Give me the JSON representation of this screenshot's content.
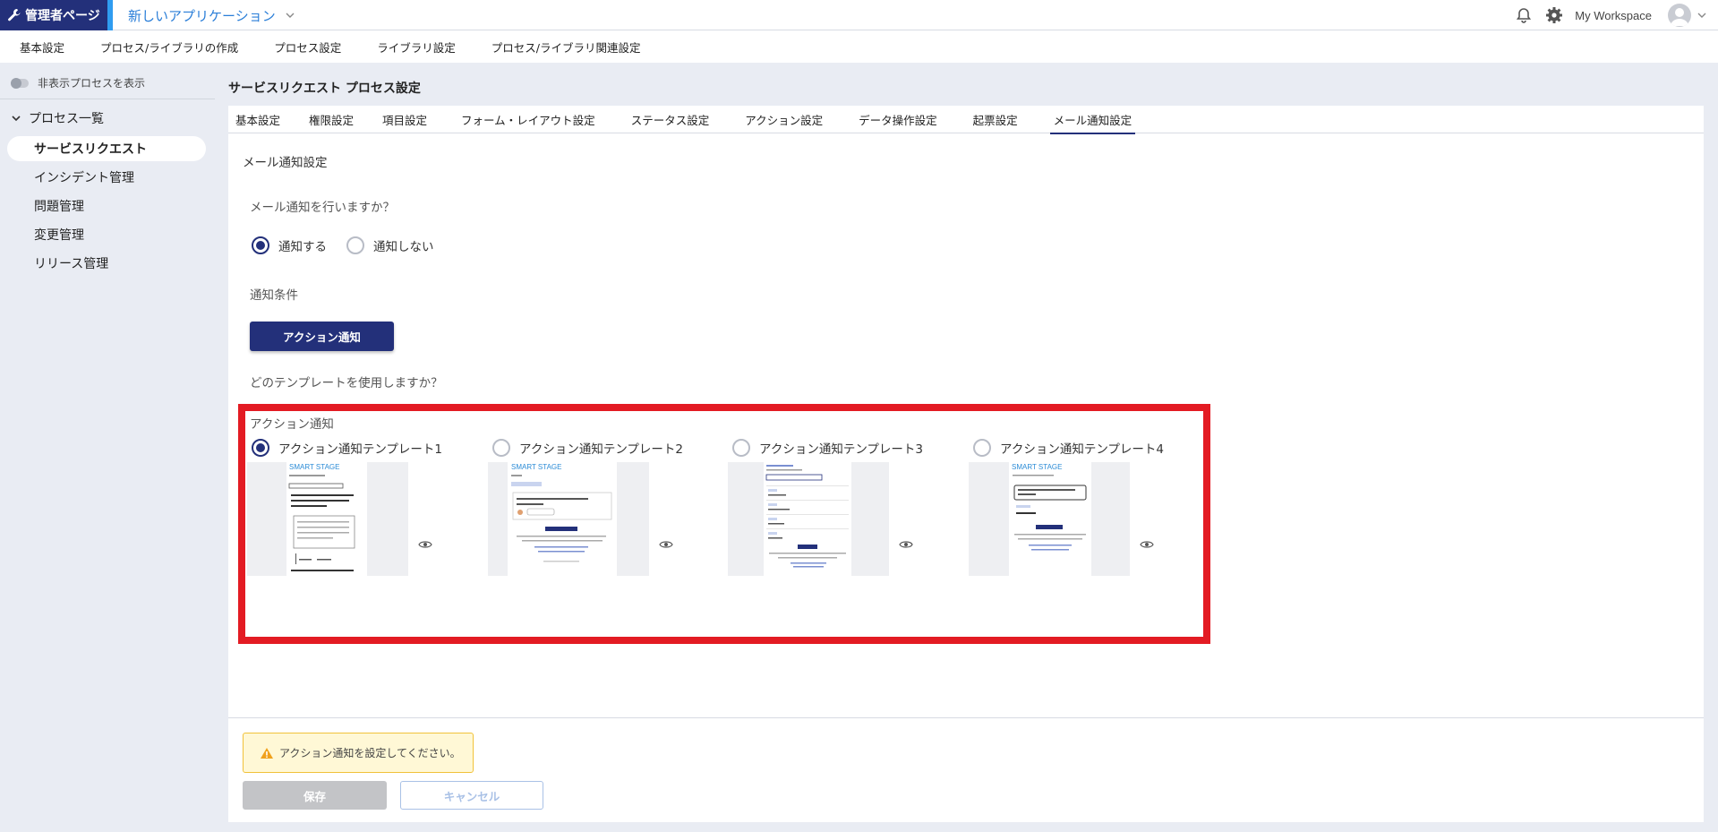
{
  "header": {
    "admin_label": "管理者ページ",
    "app_title": "新しいアプリケーション",
    "workspace": "My Workspace"
  },
  "main_nav": {
    "tabs": [
      {
        "label": "基本設定",
        "active": false
      },
      {
        "label": "プロセス/ライブラリの作成",
        "active": false
      },
      {
        "label": "プロセス設定",
        "active": true
      },
      {
        "label": "ライブラリ設定",
        "active": false
      },
      {
        "label": "プロセス/ライブラリ関連設定",
        "active": false
      }
    ]
  },
  "sidebar": {
    "toggle_label": "非表示プロセスを表示",
    "group_label": "プロセス一覧",
    "items": [
      {
        "label": "サービスリクエスト",
        "active": true
      },
      {
        "label": "インシデント管理",
        "active": false
      },
      {
        "label": "問題管理",
        "active": false
      },
      {
        "label": "変更管理",
        "active": false
      },
      {
        "label": "リリース管理",
        "active": false
      }
    ]
  },
  "page": {
    "heading": "サービスリクエスト プロセス設定",
    "subtabs": [
      {
        "label": "基本設定",
        "active": false
      },
      {
        "label": "権限設定",
        "active": false
      },
      {
        "label": "項目設定",
        "active": false
      },
      {
        "label": "フォーム・レイアウト設定",
        "active": false
      },
      {
        "label": "ステータス設定",
        "active": false
      },
      {
        "label": "アクション設定",
        "active": false
      },
      {
        "label": "データ操作設定",
        "active": false
      },
      {
        "label": "起票設定",
        "active": false
      },
      {
        "label": "メール通知設定",
        "active": true
      }
    ]
  },
  "mail": {
    "section_title": "メール通知設定",
    "question_notify": "メール通知を行いますか？",
    "options": [
      {
        "label": "通知する",
        "selected": true
      },
      {
        "label": "通知しない",
        "selected": false
      }
    ],
    "condition_title": "通知条件",
    "condition_button": "アクション通知",
    "question_template": "どのテンプレートを使用しますか？",
    "template_group_label": "アクション通知",
    "templates": [
      {
        "label": "アクション通知テンプレート1",
        "selected": true,
        "thumb_brand": "SMART STAGE"
      },
      {
        "label": "アクション通知テンプレート2",
        "selected": false,
        "thumb_brand": "SMART STAGE"
      },
      {
        "label": "アクション通知テンプレート3",
        "selected": false,
        "thumb_brand": ""
      },
      {
        "label": "アクション通知テンプレート4",
        "selected": false,
        "thumb_brand": "SMART STAGE"
      }
    ]
  },
  "footer": {
    "warning": "アクション通知を設定してください。",
    "save_label": "保存",
    "cancel_label": "キャンセル"
  },
  "colors": {
    "brand_navy": "#23307a",
    "link_blue": "#2a7ed8",
    "highlight_red": "#e31b23",
    "warning_bg": "#fff8d6"
  }
}
